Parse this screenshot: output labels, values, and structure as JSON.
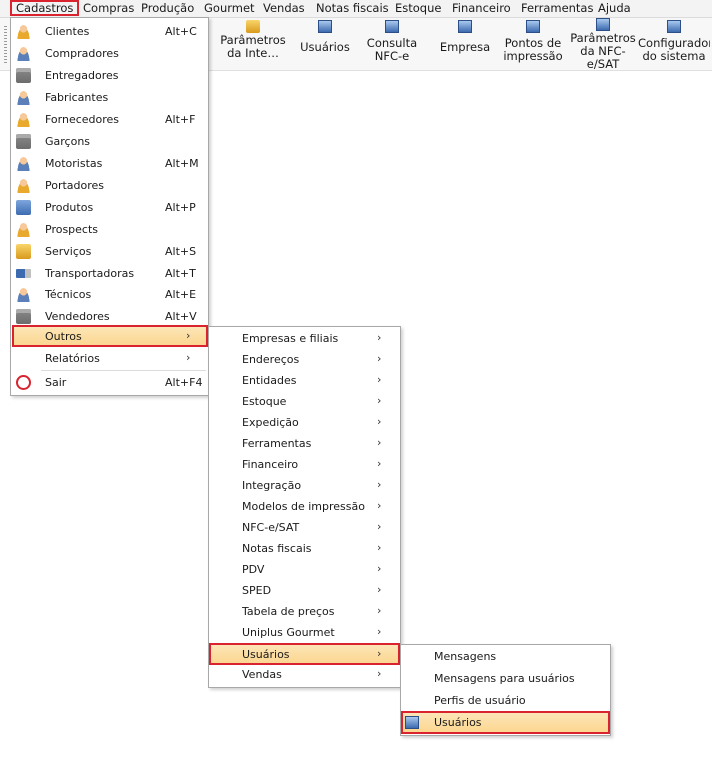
{
  "menubar": [
    {
      "label": "Cadastros",
      "active": true
    },
    {
      "label": "Compras"
    },
    {
      "label": "Produção"
    },
    {
      "label": "Gourmet"
    },
    {
      "label": "Vendas"
    },
    {
      "label": "Notas fiscais"
    },
    {
      "label": "Estoque"
    },
    {
      "label": "Financeiro"
    },
    {
      "label": "Ferramentas"
    },
    {
      "label": "Ajuda"
    }
  ],
  "toolbar": [
    {
      "label": "Parâmetros da Inte…",
      "icon": "settings-icon"
    },
    {
      "label": "Usuários",
      "icon": "users-icon"
    },
    {
      "label": "Consulta NFC-e",
      "icon": "search-doc-icon"
    },
    {
      "label": "Empresa",
      "icon": "company-icon"
    },
    {
      "label": "Pontos de impressão",
      "icon": "printer-icon"
    },
    {
      "label": "Parâmetros da NFC-e/SAT",
      "icon": "settings-icon"
    },
    {
      "label": "Configurador do sistema",
      "icon": "config-icon"
    }
  ],
  "menu_cadastros": [
    {
      "label": "Clientes",
      "shortcut": "Alt+C",
      "icon": "client-icon"
    },
    {
      "label": "Compradores",
      "shortcut": "",
      "icon": "buyer-icon"
    },
    {
      "label": "Entregadores",
      "shortcut": "",
      "icon": "courier-icon"
    },
    {
      "label": "Fabricantes",
      "shortcut": "",
      "icon": "manufacturer-icon"
    },
    {
      "label": "Fornecedores",
      "shortcut": "Alt+F",
      "icon": "supplier-icon"
    },
    {
      "label": "Garçons",
      "shortcut": "",
      "icon": "waiter-icon"
    },
    {
      "label": "Motoristas",
      "shortcut": "Alt+M",
      "icon": "driver-icon"
    },
    {
      "label": "Portadores",
      "shortcut": "",
      "icon": "carrier-icon"
    },
    {
      "label": "Produtos",
      "shortcut": "Alt+P",
      "icon": "product-icon"
    },
    {
      "label": "Prospects",
      "shortcut": "",
      "icon": "prospect-icon"
    },
    {
      "label": "Serviços",
      "shortcut": "Alt+S",
      "icon": "service-icon"
    },
    {
      "label": "Transportadoras",
      "shortcut": "Alt+T",
      "icon": "truck-icon"
    },
    {
      "label": "Técnicos",
      "shortcut": "Alt+E",
      "icon": "technician-icon"
    },
    {
      "label": "Vendedores",
      "shortcut": "Alt+V",
      "icon": "seller-icon"
    },
    {
      "label": "Outros",
      "shortcut": "",
      "submenu": true
    },
    {
      "label": "Relatórios",
      "shortcut": "",
      "submenu": true
    },
    {
      "label": "Sair",
      "shortcut": "Alt+F4",
      "icon": "power-icon"
    }
  ],
  "menu_outros": [
    "Empresas e filiais",
    "Endereços",
    "Entidades",
    "Estoque",
    "Expedição",
    "Ferramentas",
    "Financeiro",
    "Integração",
    "Modelos de impressão",
    "NFC-e/SAT",
    "Notas fiscais",
    "PDV",
    "SPED",
    "Tabela de preços",
    "Uniplus Gourmet",
    "Usuários",
    "Vendas"
  ],
  "menu_usuarios": [
    {
      "label": "Mensagens"
    },
    {
      "label": "Mensagens para usuários"
    },
    {
      "label": "Perfis de usuário"
    },
    {
      "label": "Usuários",
      "icon": "users-icon"
    }
  ],
  "submenu_arrow": "›",
  "colors": {
    "highlight": "#fbd58c",
    "selection_border": "#d9232e"
  }
}
